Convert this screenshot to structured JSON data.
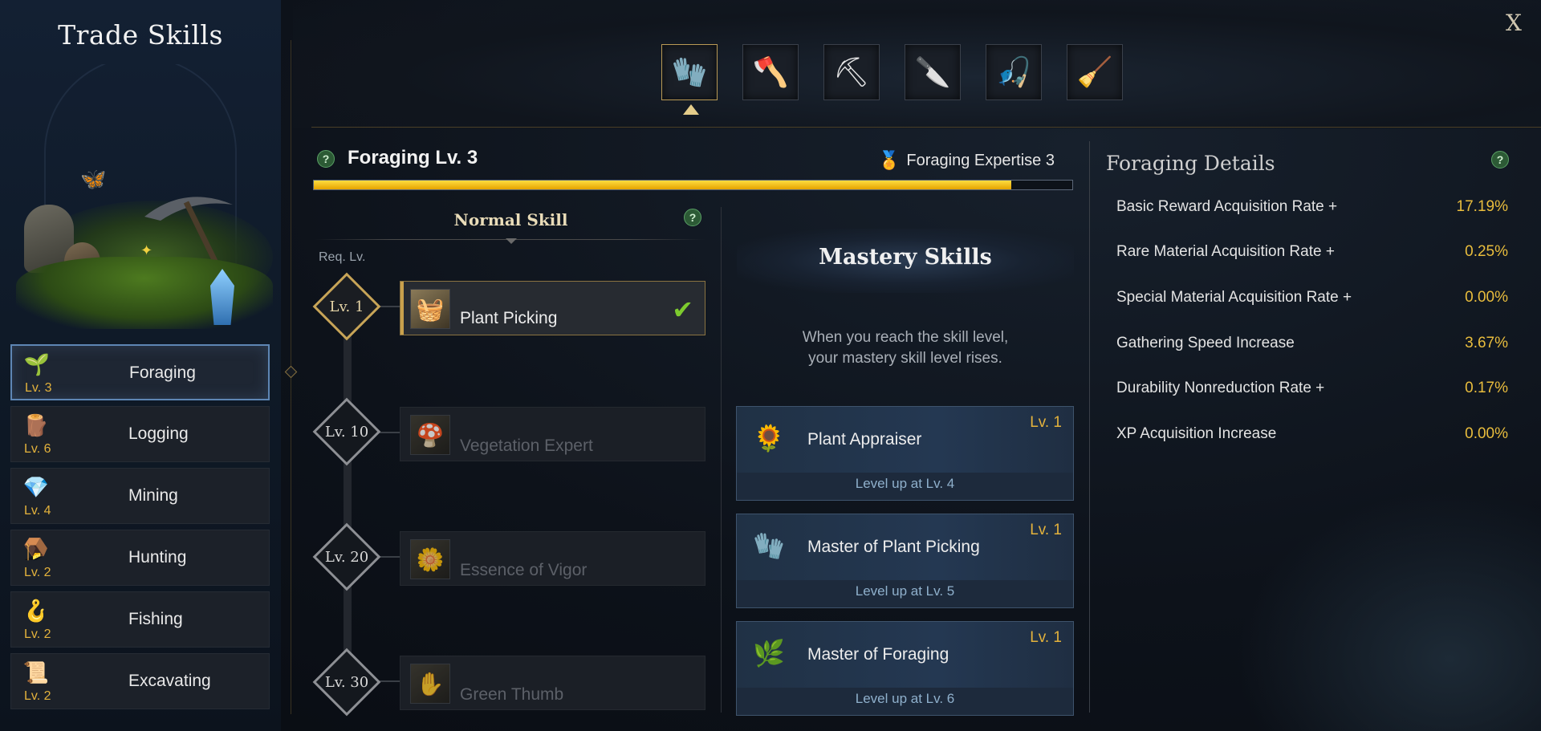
{
  "window": {
    "title": "Trade Skills",
    "close_label": "X"
  },
  "categories": [
    {
      "name": "Foraging",
      "level": "Lv. 3",
      "icon": "sprout-icon",
      "glyph": "🌱"
    },
    {
      "name": "Logging",
      "level": "Lv. 6",
      "icon": "log-icon",
      "glyph": "🪵"
    },
    {
      "name": "Mining",
      "level": "Lv. 4",
      "icon": "ore-icon",
      "glyph": "💎"
    },
    {
      "name": "Hunting",
      "level": "Lv. 2",
      "icon": "trap-icon",
      "glyph": "🪤"
    },
    {
      "name": "Fishing",
      "level": "Lv. 2",
      "icon": "hook-icon",
      "glyph": "🪝"
    },
    {
      "name": "Excavating",
      "level": "Lv. 2",
      "icon": "scroll-icon",
      "glyph": "📜"
    }
  ],
  "tool_tabs": [
    {
      "icon": "gloves-icon",
      "glyph": "🧤",
      "active": true
    },
    {
      "icon": "axe-icon",
      "glyph": "🪓",
      "active": false
    },
    {
      "icon": "pickaxe-icon",
      "glyph": "⛏",
      "active": false
    },
    {
      "icon": "knife-icon",
      "glyph": "🔪",
      "active": false
    },
    {
      "icon": "fishing-rod-icon",
      "glyph": "🎣",
      "active": false
    },
    {
      "icon": "shovel-icon",
      "glyph": "🧹",
      "active": false
    }
  ],
  "skill": {
    "title": "Foraging Lv. 3",
    "expertise": "Foraging Expertise 3",
    "progress": 0.92
  },
  "normal": {
    "header": "Normal Skill",
    "req_label": "Req. Lv.",
    "skills": [
      {
        "req": "Lv. 1",
        "name": "Plant Picking",
        "unlocked": true,
        "icon": "plant-picking-icon",
        "glyph": "🧺"
      },
      {
        "req": "Lv. 10",
        "name": "Vegetation Expert",
        "unlocked": false,
        "icon": "vegetation-expert-icon",
        "glyph": "🍄"
      },
      {
        "req": "Lv. 20",
        "name": "Essence of Vigor",
        "unlocked": false,
        "icon": "essence-of-vigor-icon",
        "glyph": "🌼"
      },
      {
        "req": "Lv. 30",
        "name": "Green Thumb",
        "unlocked": false,
        "icon": "green-thumb-icon",
        "glyph": "✋"
      }
    ]
  },
  "mastery": {
    "title": "Mastery Skills",
    "description_line1": "When you reach the skill level,",
    "description_line2": "your mastery skill level rises.",
    "skills": [
      {
        "name": "Plant Appraiser",
        "level": "Lv. 1",
        "levelup": "Level up at Lv. 4",
        "icon": "plant-appraiser-icon",
        "glyph": "🌻"
      },
      {
        "name": "Master of Plant Picking",
        "level": "Lv. 1",
        "levelup": "Level up at Lv. 5",
        "icon": "master-plant-picking-icon",
        "glyph": "🧤"
      },
      {
        "name": "Master of Foraging",
        "level": "Lv. 1",
        "levelup": "Level up at Lv. 6",
        "icon": "master-foraging-icon",
        "glyph": "🌿"
      }
    ]
  },
  "details": {
    "title": "Foraging Details",
    "rows": [
      {
        "label": "Basic Reward Acquisition Rate +",
        "value": "17.19%"
      },
      {
        "label": "Rare Material Acquisition Rate +",
        "value": "0.25%"
      },
      {
        "label": "Special Material Acquisition Rate +",
        "value": "0.00%"
      },
      {
        "label": "Gathering Speed Increase",
        "value": "3.67%"
      },
      {
        "label": "Durability Nonreduction Rate +",
        "value": "0.17%"
      },
      {
        "label": "XP Acquisition Increase",
        "value": "0.00%"
      }
    ]
  },
  "colors": {
    "accent_gold": "#e3b23c",
    "check_green": "#7dcb2e",
    "progress_yellow": "#ffdd40"
  }
}
